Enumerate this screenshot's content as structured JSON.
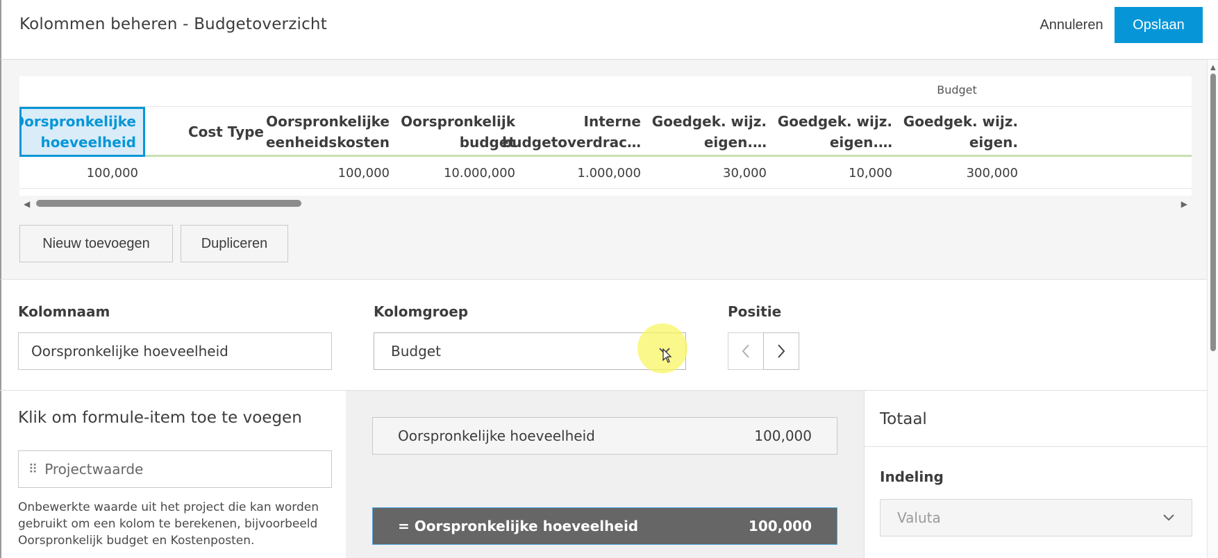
{
  "header": {
    "title": "Kolommen beheren - Budgetoverzicht",
    "cancel_label": "Annuleren",
    "save_label": "Opslaan"
  },
  "preview": {
    "group_label": "Budget",
    "columns": [
      {
        "header": [
          "Oorspronkelijke",
          "hoeveelheid"
        ],
        "value": "100,000",
        "selected": true
      },
      {
        "header": [
          "Cost Type"
        ],
        "value": ""
      },
      {
        "header": [
          "Oorspronkelijke",
          "eenheidskosten"
        ],
        "value": "100,000"
      },
      {
        "header": [
          "Oorspronkelijk",
          "budget"
        ],
        "value": "10.000,000"
      },
      {
        "header": [
          "Interne",
          "budgetoverdrac…"
        ],
        "value": "1.000,000"
      },
      {
        "header": [
          "Goedgek. wijz.",
          "eigen.…"
        ],
        "value": "30,000"
      },
      {
        "header": [
          "Goedgek. wijz.",
          "eigen.…"
        ],
        "value": "10,000"
      },
      {
        "header": [
          "Goedgek. wijz.",
          "eigen."
        ],
        "value": "300,000"
      }
    ],
    "add_label": "Nieuw toevoegen",
    "duplicate_label": "Dupliceren"
  },
  "fields": {
    "name_label": "Kolomnaam",
    "name_value": "Oorspronkelijke hoeveelheid",
    "group_label": "Kolomgroep",
    "group_value": "Budget",
    "position_label": "Positie"
  },
  "formula_panel": {
    "title": "Klik om formule-item toe te voegen",
    "item_label": "Projectwaarde",
    "description": "Onbewerkte waarde uit het project die kan worden gebruikt om een kolom te berekenen, bijvoorbeeld Oorspronkelijk budget en Kostenposten."
  },
  "formula": {
    "item_name": "Oorspronkelijke hoeveelheid",
    "item_value": "100,000",
    "result_name": "= Oorspronkelijke hoeveelheid",
    "result_value": "100,000"
  },
  "total_panel": {
    "title": "Totaal",
    "format_label": "Indeling",
    "format_value": "Valuta"
  },
  "colors": {
    "accent": "#0696d7",
    "selected_bg": "#d9ecf8",
    "result_bg": "#666666",
    "header_underline": "#c8dfb0"
  }
}
